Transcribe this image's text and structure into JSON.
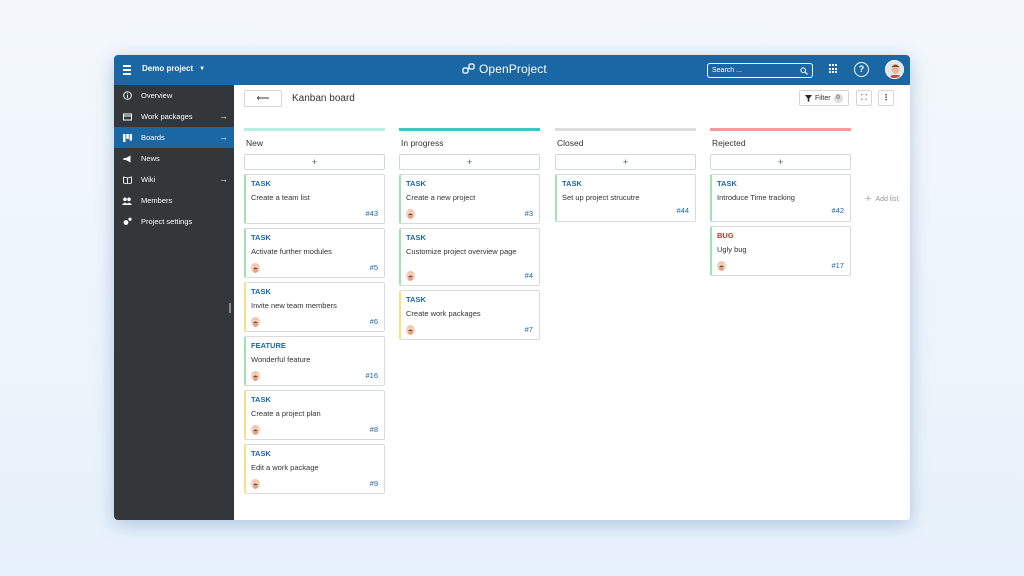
{
  "header": {
    "project_name": "Demo project",
    "logo_text": "OpenProject",
    "search_placeholder": "Search ...",
    "help_label": "?"
  },
  "sidebar": {
    "items": [
      {
        "label": "Overview",
        "icon": "info-icon"
      },
      {
        "label": "Work packages",
        "icon": "work-packages-icon",
        "arrow": "→"
      },
      {
        "label": "Boards",
        "icon": "boards-icon",
        "arrow": "→",
        "active": true
      },
      {
        "label": "News",
        "icon": "megaphone-icon"
      },
      {
        "label": "Wiki",
        "icon": "book-icon",
        "arrow": "→"
      },
      {
        "label": "Members",
        "icon": "members-icon"
      },
      {
        "label": "Project settings",
        "icon": "settings-icon"
      }
    ]
  },
  "toolbar": {
    "back_label": "⟵",
    "title": "Kanban board",
    "filter_label": "Filter",
    "filter_count": "0",
    "fullscreen_label": "⛶",
    "more_label": "⋮"
  },
  "board": {
    "add_card_label": "+",
    "add_list_label": "Add list",
    "add_list_icon": "+",
    "columns": [
      {
        "title": "New",
        "color": "#9ee6d6",
        "cards": [
          {
            "type": "TASK",
            "subject": "Create a team list",
            "id": "#43"
          },
          {
            "type": "TASK",
            "subject": "Activate further modules",
            "id": "#5"
          },
          {
            "type": "TASK",
            "subject": "Invite new team members",
            "id": "#6"
          },
          {
            "type": "FEATURE",
            "subject": "Wonderful feature",
            "id": "#16"
          },
          {
            "type": "TASK",
            "subject": "Create a project plan",
            "id": "#8"
          },
          {
            "type": "TASK",
            "subject": "Edit a work package",
            "id": "#9"
          }
        ]
      },
      {
        "title": "In progress",
        "color": "#3fc7c4",
        "cards": [
          {
            "type": "TASK",
            "subject": "Create a new project",
            "id": "#3"
          },
          {
            "type": "TASK",
            "subject": "Customize project overview page",
            "id": "#4"
          },
          {
            "type": "TASK",
            "subject": "Create work packages",
            "id": "#7"
          }
        ]
      },
      {
        "title": "Closed",
        "color": "#dcdcdc",
        "cards": [
          {
            "type": "TASK",
            "subject": "Set up project strucutre",
            "id": "#44"
          }
        ]
      },
      {
        "title": "Rejected",
        "color": "#f59a9a",
        "cards": [
          {
            "type": "TASK",
            "subject": "Introduce Time tracking",
            "id": "#42"
          },
          {
            "type": "BUG",
            "subject": "Ugly bug",
            "id": "#17"
          }
        ]
      }
    ]
  }
}
